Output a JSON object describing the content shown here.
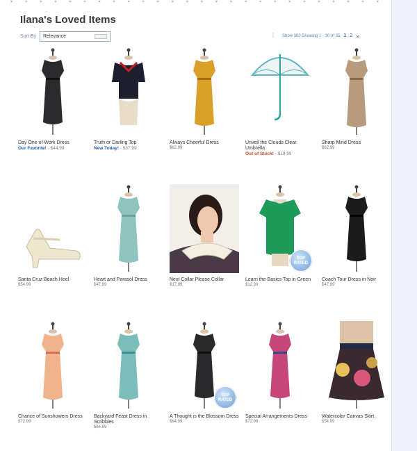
{
  "page": {
    "title": "Ilana's Loved Items"
  },
  "sort": {
    "label": "Sort By",
    "value": "Relevance"
  },
  "pagination": {
    "show_text": "Show 300  Showing 1 - 30 of 35",
    "pages": [
      "1",
      "2"
    ],
    "next_icon": "chevron-right-icon"
  },
  "items": [
    {
      "name": "Day One of Work Dress",
      "tag": "Our Favorite!",
      "tag_color": "#2060b0",
      "price": "- $44.99",
      "image": "black-dress-polka"
    },
    {
      "name": "Truth or Darling Top",
      "tag": "New Today!",
      "tag_color": "#2060b0",
      "price": "- $37.99",
      "image": "navy-polka-top"
    },
    {
      "name": "Always Cheerful Dress",
      "tag": "",
      "price": "$62.99",
      "image": "mustard-floral-dress"
    },
    {
      "name": "Unveil the Clouds Clear Umbrella",
      "tag": "Out of Stock!",
      "tag_color": "#d0402a",
      "price": "- $19.99",
      "image": "clear-umbrella"
    },
    {
      "name": "Sharp Mind Dress",
      "tag": "",
      "price": "$62.99",
      "image": "brown-print-dress"
    },
    {
      "name": "Santa Cruz Beach Heel",
      "tag": "",
      "price": "$54.99",
      "image": "cream-heel"
    },
    {
      "name": "Heart and Parasol Dress",
      "tag": "",
      "price": "$47.99",
      "image": "mint-dress"
    },
    {
      "name": "Next Collar Please Collar",
      "tag": "",
      "price": "$17.99",
      "image": "lace-collar"
    },
    {
      "name": "Learn the Basics Top in Green",
      "tag": "",
      "price": "$12.99",
      "image": "green-tee",
      "badge": "TOP RATED"
    },
    {
      "name": "Coach Tour Dress in Noir",
      "tag": "",
      "price": "$47.99",
      "image": "black-sleeveless-dress"
    },
    {
      "name": "Chance of Sunshowers Dress",
      "tag": "",
      "price": "$72.99",
      "image": "peach-floral-dress"
    },
    {
      "name": "Backyard Feast Dress in Scribbles",
      "tag": "",
      "price": "$64.99",
      "image": "teal-leaf-dress"
    },
    {
      "name": "A Thought is the Blossom Dress",
      "tag": "",
      "price": "$64.99",
      "image": "black-floral-dress",
      "badge": "TOP RATED"
    },
    {
      "name": "Special Arrangements Dress",
      "tag": "",
      "price": "$72.99",
      "image": "bright-floral-dress"
    },
    {
      "name": "Watercolor Canvas Skirt",
      "tag": "",
      "price": "$54.99",
      "image": "floral-skirt"
    }
  ],
  "colors": {
    "accent_blue": "#2060b0",
    "out_of_stock": "#d0402a",
    "side_panel": "#eef1fb",
    "heart_pink": "#f2a7b8"
  }
}
